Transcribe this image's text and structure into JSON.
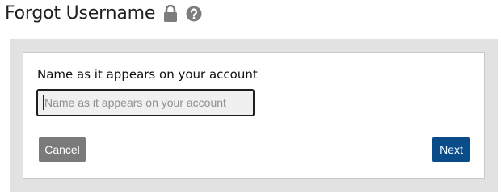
{
  "header": {
    "title": "Forgot Username",
    "icons": [
      "lock-icon",
      "help-icon"
    ]
  },
  "form": {
    "name_label": "Name as it appears on your account",
    "name_placeholder": "Name as it appears on your account",
    "name_value": ""
  },
  "actions": {
    "cancel_label": "Cancel",
    "next_label": "Next"
  },
  "colors": {
    "panel_bg": "#e2e2e2",
    "cancel_button": "#7a7a7a",
    "next_button": "#0a4c8a",
    "icon_gray": "#7d7d7d"
  }
}
